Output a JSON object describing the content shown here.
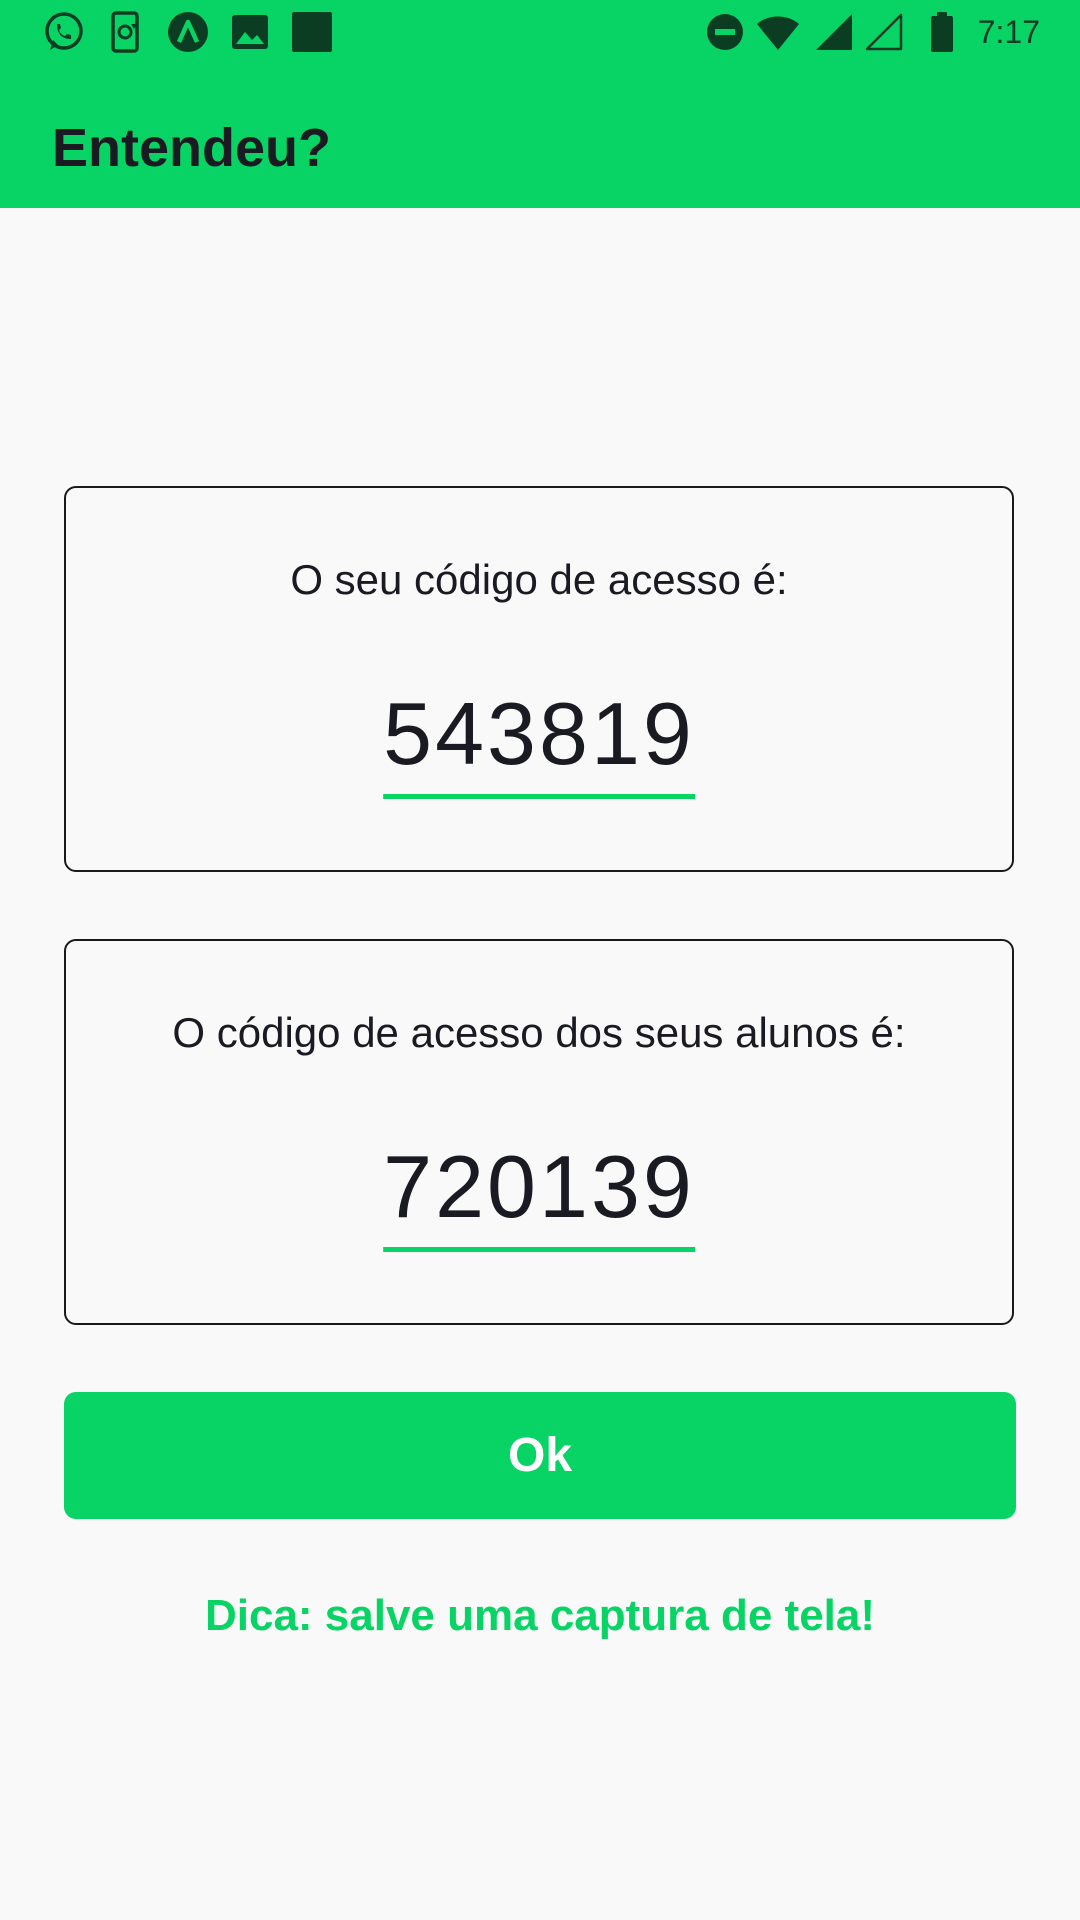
{
  "status_bar": {
    "time": "7:17",
    "left_icons": [
      "whatsapp-icon",
      "phone-sync-icon",
      "app-a-icon",
      "image-icon",
      "square-app-icon"
    ],
    "right_icons": [
      "do-not-disturb-icon",
      "wifi-icon",
      "signal-icon",
      "signal-empty-icon",
      "battery-icon"
    ]
  },
  "header": {
    "title": "Entendeu?"
  },
  "cards": [
    {
      "label": "O seu código de acesso é:",
      "code": "543819"
    },
    {
      "label": "O código de acesso dos seus alunos é:",
      "code": "720139"
    }
  ],
  "actions": {
    "ok_label": "Ok"
  },
  "tip": "Dica: salve uma captura de tela!",
  "colors": {
    "accent": "#07d465",
    "text": "#1a1a22",
    "background": "#f9f9f9"
  }
}
